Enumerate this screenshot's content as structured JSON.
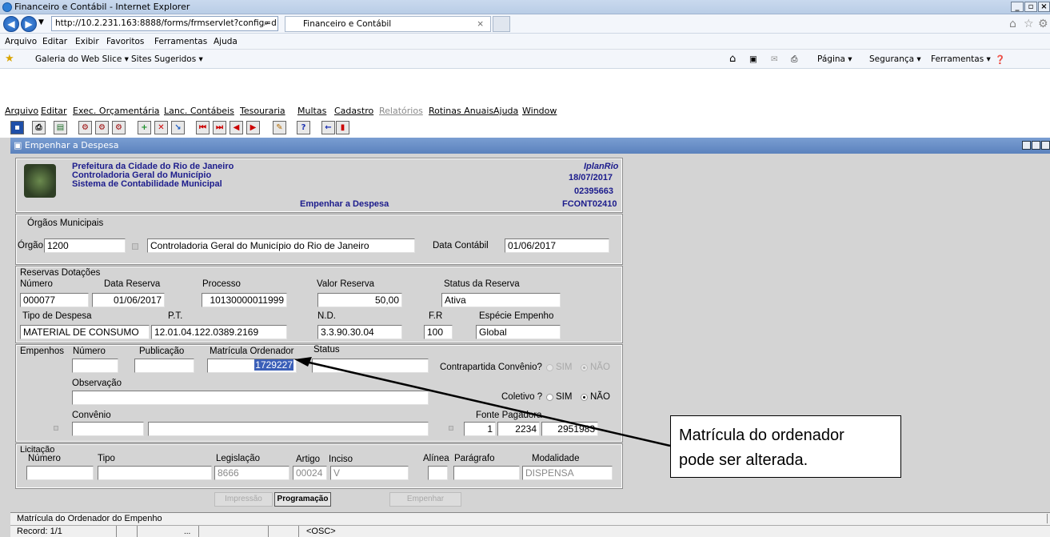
{
  "browser": {
    "window_title": "Financeiro e Contábil - Internet Explorer",
    "address": "http://10.2.231.163:8888/forms/frmservlet?config=d",
    "tab_label": "Financeiro e Contábil",
    "menu": [
      "Arquivo",
      "Editar",
      "Exibir",
      "Favoritos",
      "Ferramentas",
      "Ajuda"
    ],
    "favorites": [
      "Galeria do Web Slice ▾",
      "Sites Sugeridos ▾"
    ],
    "command_bar": [
      "Página ▾",
      "Segurança ▾",
      "Ferramentas ▾"
    ]
  },
  "app_menu": [
    {
      "label": "Arquivo",
      "enabled": true
    },
    {
      "label": "Editar",
      "enabled": true
    },
    {
      "label": "Exec. Orçamentária",
      "enabled": true
    },
    {
      "label": "Lanc. Contábeis",
      "enabled": true
    },
    {
      "label": "Tesouraria",
      "enabled": true
    },
    {
      "label": "Multas",
      "enabled": true
    },
    {
      "label": "Cadastro",
      "enabled": true
    },
    {
      "label": "Relatórios",
      "enabled": false
    },
    {
      "label": "Rotinas Anuais",
      "enabled": true
    },
    {
      "label": "Ajuda",
      "enabled": true
    },
    {
      "label": "Window",
      "enabled": true
    }
  ],
  "form": {
    "window_title": "Empenhar a Despesa",
    "header": {
      "org1": "Prefeitura da Cidade do Rio de Janeiro",
      "org2": "Controladoria Geral do Município",
      "org3": "Sistema de Contabilidade Municipal",
      "screen": "Empenhar a Despesa",
      "sys": "IplanRio",
      "date": "18/07/2017",
      "user": "02395663",
      "code": "FCONT02410"
    },
    "orgaos": {
      "section": "Órgãos Municipais",
      "orgao_label": "Órgão",
      "orgao_value": "1200",
      "orgao_name": "Controladoria Geral do Município do Rio de Janeiro",
      "data_contabil_label": "Data Contábil",
      "data_contabil_value": "01/06/2017"
    },
    "reservas": {
      "section": "Reservas Dotações",
      "numero_label": "Número",
      "numero": "000077",
      "data_reserva_label": "Data Reserva",
      "data_reserva": "01/06/2017",
      "processo_label": "Processo",
      "processo": "10130000011999",
      "valor_label": "Valor Reserva",
      "valor": "50,00",
      "status_label": "Status da Reserva",
      "status": "Ativa",
      "tipo_label": "Tipo de Despesa",
      "tipo": "MATERIAL DE CONSUMO",
      "pt_label": "P.T.",
      "pt": "12.01.04.122.0389.2169",
      "nd_label": "N.D.",
      "nd": "3.3.90.30.04",
      "fr_label": "F.R",
      "fr": "100",
      "especie_label": "Espécie Empenho",
      "especie": "Global"
    },
    "empenhos": {
      "section": "Empenhos",
      "numero_label": "Número",
      "publicacao_label": "Publicação",
      "matricula_label": "Matrícula Ordenador",
      "matricula": "1729227",
      "status_label": "Status",
      "contrapartida_label": "Contrapartida Convênio?",
      "sim": "SIM",
      "nao": "NÃO",
      "observacao_label": "Observação",
      "coletivo_label": "Coletivo ?",
      "convenio_label": "Convênio",
      "fonte_label": "Fonte Pagadora",
      "fonte1": "1",
      "fonte2": "2234",
      "fonte3": "2951983"
    },
    "licitacao": {
      "section": "Licitação",
      "numero_label": "Número",
      "tipo_label": "Tipo",
      "legislacao_label": "Legislação",
      "legislacao": "8666",
      "artigo_label": "Artigo",
      "artigo": "00024",
      "inciso_label": "Inciso",
      "inciso": "V",
      "alinea_label": "Alínea",
      "paragrafo_label": "Parágrafo",
      "modalidade_label": "Modalidade",
      "modalidade": "DISPENSA"
    },
    "buttons": {
      "impressao": "Impressão",
      "programacao": "Programação",
      "empenhar": "Empenhar"
    }
  },
  "status": {
    "hint": "Matrícula do Ordenador do Empenho",
    "record": "Record: 1/1",
    "dots": "...",
    "osc": "<OSC>"
  },
  "annotation": {
    "text": "Matrícula do ordenador\npode ser alterada."
  },
  "colors": {
    "window_title_bg": "#5b82bd",
    "canvas": "#d4d4d4",
    "header_text": "#1c1c8c",
    "selection": "#3b5fb8"
  }
}
